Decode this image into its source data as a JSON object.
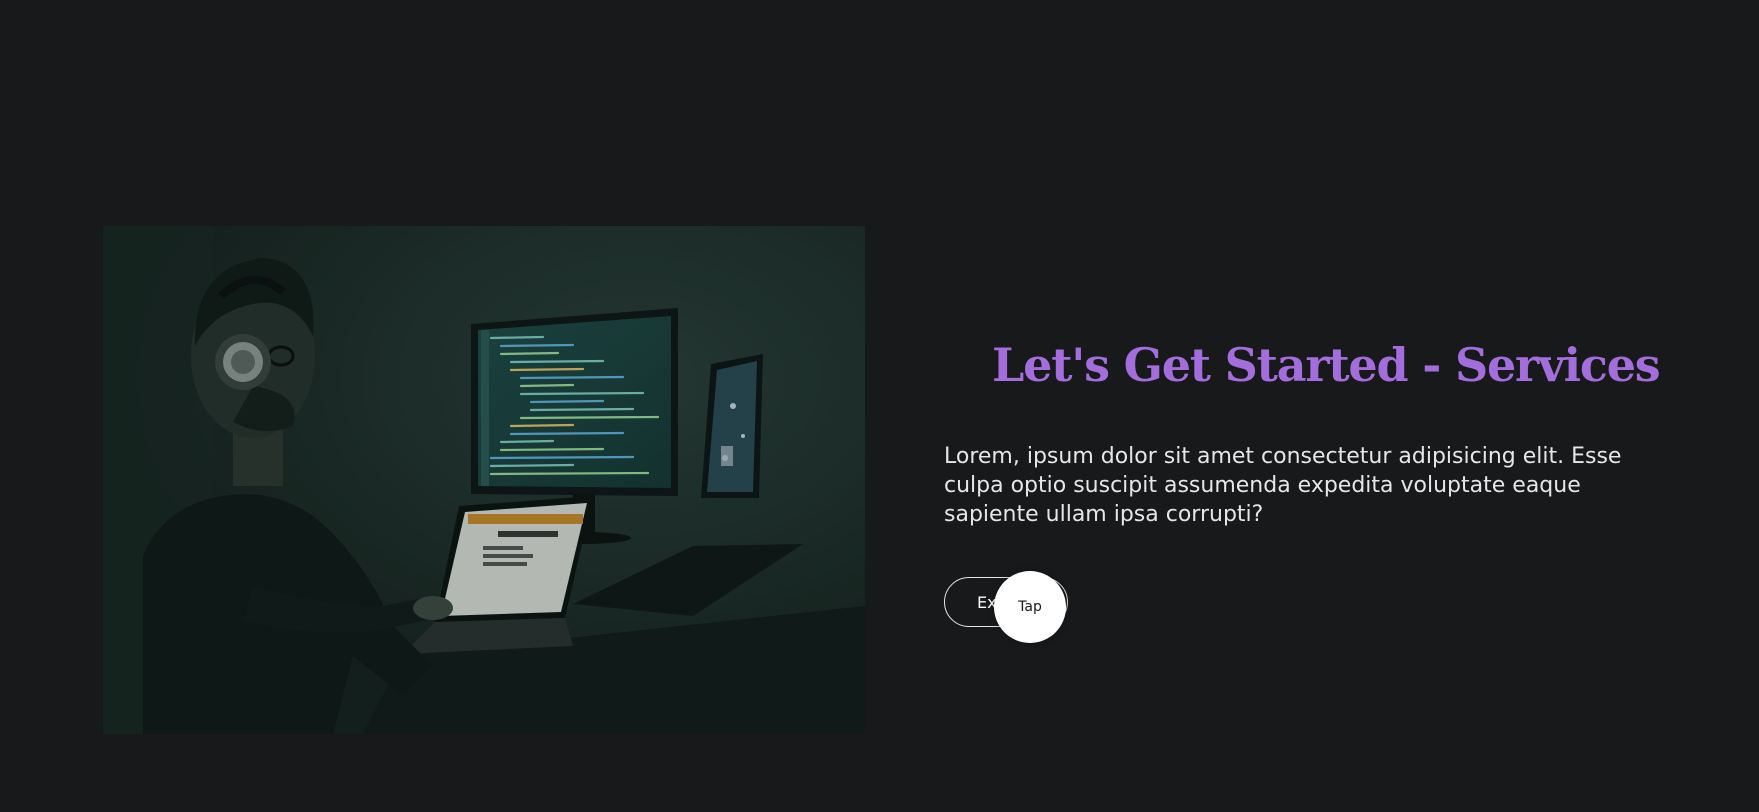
{
  "hero": {
    "image_description": "Person wearing headphones coding on a laptop in a dark room with monitors"
  },
  "content": {
    "title": "Let's Get Started - Services",
    "description": "Lorem, ipsum dolor sit amet consectetur adipisicing elit. Esse culpa optio suscipit assumenda expedita voluptate eaque sapiente ullam ipsa corrupti?",
    "cta_label": "Explore",
    "cursor_label": "Tap"
  },
  "colors": {
    "background": "#17191b",
    "accent": "#a36ddc",
    "text": "#e6e6e6"
  }
}
